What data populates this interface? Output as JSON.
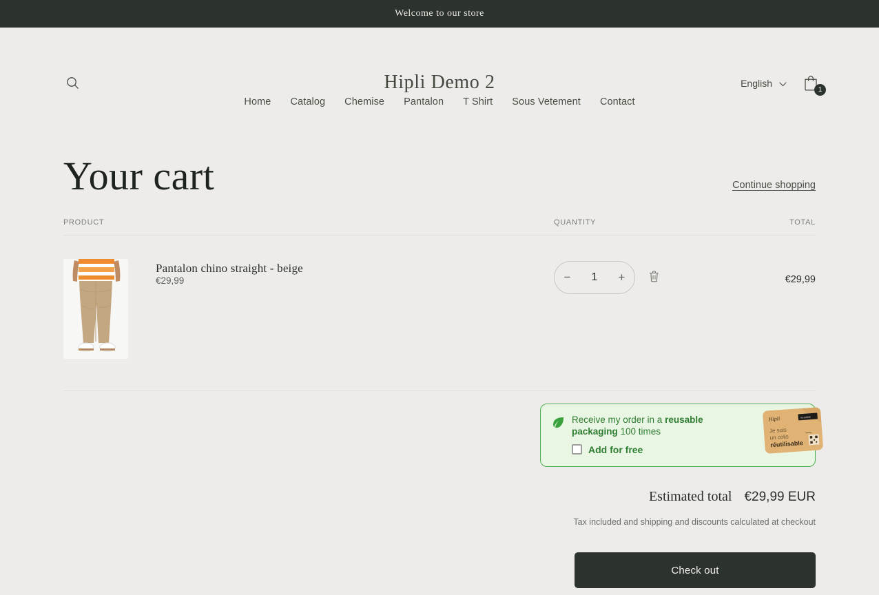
{
  "announcement": {
    "text": "Welcome to our store"
  },
  "header": {
    "shop_title": "Hipli Demo 2",
    "search_icon": "search-icon",
    "language": {
      "label": "English",
      "chevron_icon": "chevron-down-icon"
    },
    "cart": {
      "icon": "shopping-bag-icon",
      "count": "1"
    }
  },
  "nav": {
    "items": [
      {
        "label": "Home"
      },
      {
        "label": "Catalog"
      },
      {
        "label": "Chemise"
      },
      {
        "label": "Pantalon"
      },
      {
        "label": "T Shirt"
      },
      {
        "label": "Sous Vetement"
      },
      {
        "label": "Contact"
      }
    ]
  },
  "cart": {
    "title": "Your cart",
    "continue_shopping": "Continue shopping",
    "columns": {
      "product": "PRODUCT",
      "quantity": "QUANTITY",
      "total": "TOTAL"
    },
    "items": [
      {
        "title": "Pantalon chino straight - beige",
        "price": "€29,99",
        "quantity": "1",
        "total": "€29,99",
        "decrease_label": "−",
        "increase_label": "+",
        "remove_icon": "trash-icon",
        "image_alt": "beige chino trousers worn with orange striped shirt"
      }
    ]
  },
  "eco_banner": {
    "leaf_icon": "leaf-icon",
    "text_prefix": "Receive my order in a ",
    "text_bold": "reusable packaging",
    "text_suffix": " 100 times",
    "add_for_free": "Add for free",
    "checkbox_icon": "checkbox-unchecked-icon",
    "parcel": {
      "brand": "Hipli",
      "line1": "Je suis",
      "line2": "un colis",
      "line3": "réutilisable",
      "qr_icon": "qr-code-icon"
    },
    "colors": {
      "border": "#4caf50",
      "background": "#e9f6e3",
      "text": "#2f7d32"
    }
  },
  "summary": {
    "estimated_total_label": "Estimated total",
    "estimated_total_value": "€29,99 EUR",
    "tax_note": "Tax included and shipping and discounts calculated at checkout",
    "checkout_label": "Check out"
  },
  "colors": {
    "page_background": "#edecea",
    "dark": "#2c322c",
    "divider": "#e1e0dc"
  }
}
